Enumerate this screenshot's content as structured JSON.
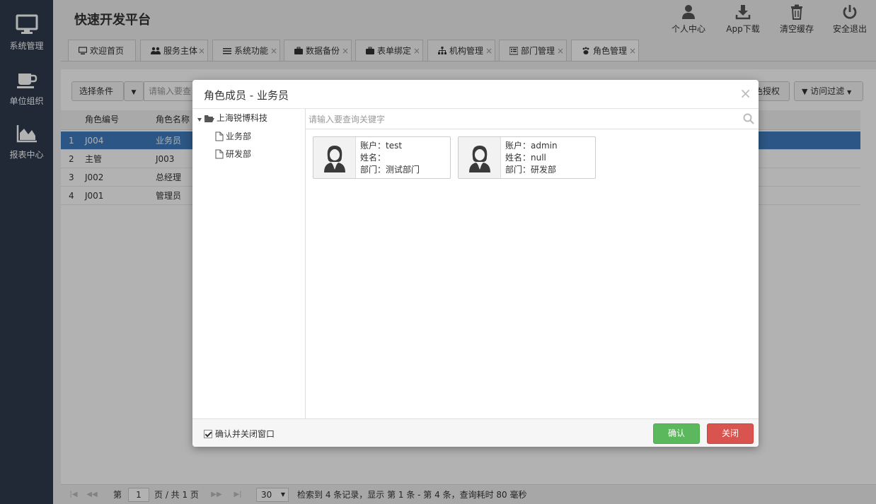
{
  "app": {
    "title": "快速开发平台"
  },
  "sidebar": {
    "items": [
      {
        "label": "系统管理",
        "icon": "monitor-icon"
      },
      {
        "label": "单位组织",
        "icon": "coffee-icon"
      },
      {
        "label": "报表中心",
        "icon": "area-chart-icon"
      }
    ]
  },
  "header": {
    "actions": [
      {
        "label": "个人中心",
        "icon": "user-icon"
      },
      {
        "label": "App下载",
        "icon": "download-icon"
      },
      {
        "label": "清空缓存",
        "icon": "trash-icon"
      },
      {
        "label": "安全退出",
        "icon": "power-icon"
      }
    ]
  },
  "tabs": [
    {
      "label": "欢迎首页",
      "icon": "desktop-icon",
      "closable": false
    },
    {
      "label": "服务主体",
      "icon": "users-icon",
      "closable": true
    },
    {
      "label": "系统功能",
      "icon": "list-icon",
      "closable": true
    },
    {
      "label": "数据备份",
      "icon": "briefcase-icon",
      "closable": true
    },
    {
      "label": "表单绑定",
      "icon": "briefcase-icon",
      "closable": true
    },
    {
      "label": "机构管理",
      "icon": "sitemap-icon",
      "closable": true
    },
    {
      "label": "部门管理",
      "icon": "list-alt-icon",
      "closable": true
    },
    {
      "label": "角色管理",
      "icon": "paw-icon",
      "closable": true,
      "active": true
    }
  ],
  "content": {
    "toolbar": {
      "select_label": "选择条件",
      "search_placeholder": "请输入要查",
      "grant_label": "色授权",
      "filter_label": "访问过滤"
    },
    "grid": {
      "columns": [
        "角色编号",
        "角色名称"
      ],
      "rows": [
        {
          "num": "1",
          "code": "J004",
          "name": "业务员",
          "selected": true
        },
        {
          "num": "2",
          "code": "主管",
          "name": "J003"
        },
        {
          "num": "3",
          "code": "J002",
          "name": "总经理"
        },
        {
          "num": "4",
          "code": "J001",
          "name": "管理员"
        }
      ]
    },
    "pager": {
      "page_prefix": "第",
      "page": "1",
      "page_suffix": "页 / 共 1 页",
      "page_size": "30",
      "summary": "检索到 4 条记录，显示 第 1 条 - 第 4 条，查询耗时 80 毫秒"
    }
  },
  "modal": {
    "title": "角色成员 - 业务员",
    "close_glyph": "×",
    "tree": {
      "root": "上海锐博科技",
      "children": [
        "业务部",
        "研发部"
      ]
    },
    "search_placeholder": "请输入要查询关键字",
    "members": [
      {
        "account": "账户：test",
        "name": "姓名：",
        "dept": "部门：测试部门"
      },
      {
        "account": "账户：admin",
        "name": "姓名：null",
        "dept": "部门：研发部"
      }
    ],
    "footer": {
      "checkbox_label": "确认并关闭窗口",
      "confirm_label": "确认",
      "close_label": "关闭"
    }
  },
  "colors": {
    "sidebar_bg": "#2f3b4c",
    "selected_row": "#3f7bbf",
    "confirm_green": "#5cb85c",
    "close_red": "#d9534f"
  }
}
